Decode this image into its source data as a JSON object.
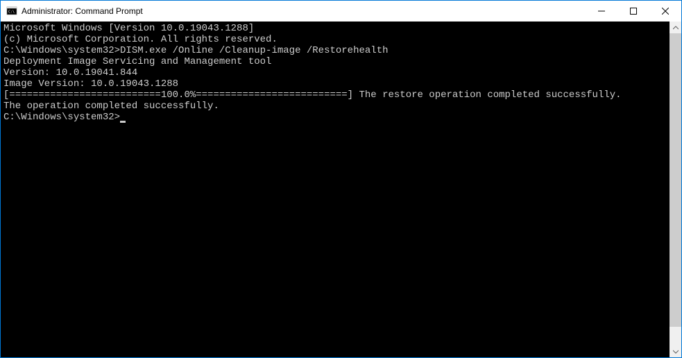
{
  "titlebar": {
    "title": "Administrator: Command Prompt"
  },
  "console": {
    "lines": [
      "Microsoft Windows [Version 10.0.19043.1288]",
      "(c) Microsoft Corporation. All rights reserved.",
      "",
      "C:\\Windows\\system32>DISM.exe /Online /Cleanup-image /Restorehealth",
      "",
      "Deployment Image Servicing and Management tool",
      "Version: 10.0.19041.844",
      "",
      "Image Version: 10.0.19043.1288",
      "",
      "[==========================100.0%==========================] The restore operation completed successfully.",
      "The operation completed successfully.",
      ""
    ],
    "prompt": "C:\\Windows\\system32>"
  }
}
